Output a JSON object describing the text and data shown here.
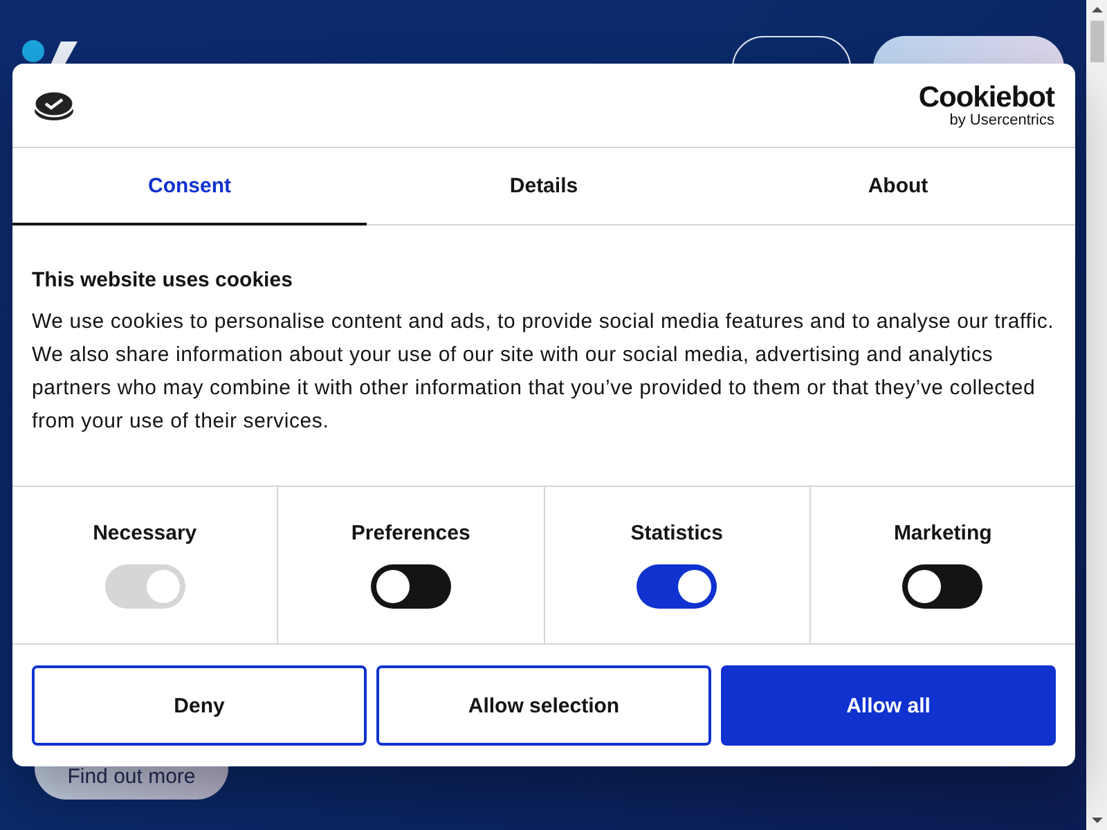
{
  "page": {
    "cta": "Find out more"
  },
  "dialog": {
    "brand": "Cookiebot",
    "brand_sub": "by Usercentrics",
    "tabs": [
      {
        "label": "Consent",
        "selected": true
      },
      {
        "label": "Details",
        "selected": false
      },
      {
        "label": "About",
        "selected": false
      }
    ],
    "heading": "This website uses cookies",
    "body": "We use cookies to personalise content and ads, to provide social media features and to analyse our traffic. We also share information about your use of our site with our social media, advertising and analytics partners who may combine it with other information that you’ve provided to them or that they’ve collected from your use of their services.",
    "categories": [
      {
        "label": "Necessary",
        "on": true,
        "disabled": true
      },
      {
        "label": "Preferences",
        "on": false,
        "disabled": false
      },
      {
        "label": "Statistics",
        "on": true,
        "disabled": false
      },
      {
        "label": "Marketing",
        "on": false,
        "disabled": false
      }
    ],
    "buttons": [
      {
        "label": "Deny",
        "kind": "outline"
      },
      {
        "label": "Allow selection",
        "kind": "outline"
      },
      {
        "label": "Allow all",
        "kind": "primary"
      }
    ]
  }
}
